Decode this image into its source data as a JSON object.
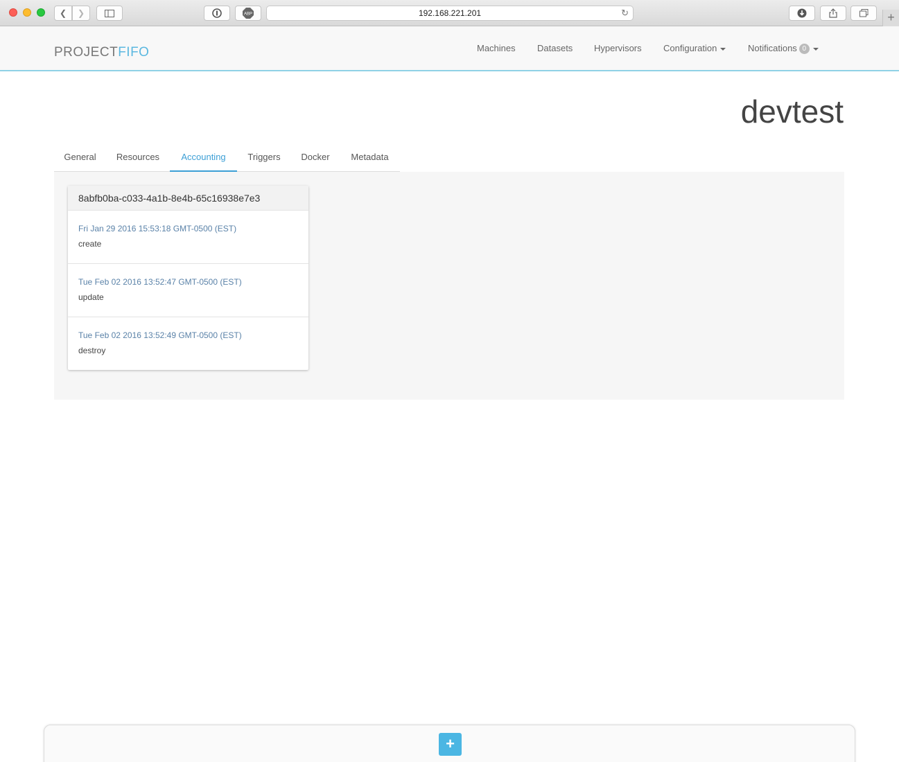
{
  "browser": {
    "url": "192.168.221.201",
    "icons": [
      "back-icon",
      "forward-icon",
      "sidebar-icon",
      "password-icon",
      "adblock-icon",
      "reload-icon",
      "download-icon",
      "share-icon",
      "tabs-icon",
      "new-tab-icon"
    ]
  },
  "navbar": {
    "logo_left": "PROJECT",
    "logo_right": "FIFO",
    "links": {
      "machines": "Machines",
      "datasets": "Datasets",
      "hypervisors": "Hypervisors",
      "configuration": "Configuration",
      "notifications": "Notifications"
    },
    "notifications_count": "0"
  },
  "page": {
    "title": "devtest"
  },
  "tabs": {
    "general": "General",
    "resources": "Resources",
    "accounting": "Accounting",
    "triggers": "Triggers",
    "docker": "Docker",
    "metadata": "Metadata",
    "active": "accounting"
  },
  "accounting": {
    "uuid": "8abfb0ba-c033-4a1b-8e4b-65c16938e7e3",
    "entries": [
      {
        "date": "Fri Jan 29 2016 15:53:18 GMT-0500 (EST)",
        "action": "create"
      },
      {
        "date": "Tue Feb 02 2016 13:52:47 GMT-0500 (EST)",
        "action": "update"
      },
      {
        "date": "Tue Feb 02 2016 13:52:49 GMT-0500 (EST)",
        "action": "destroy"
      }
    ]
  },
  "footer": {
    "add_label": "+"
  },
  "colors": {
    "accent": "#3c9fd6",
    "add_button": "#4bb6e3",
    "logo_accent": "#5bb8e0"
  }
}
